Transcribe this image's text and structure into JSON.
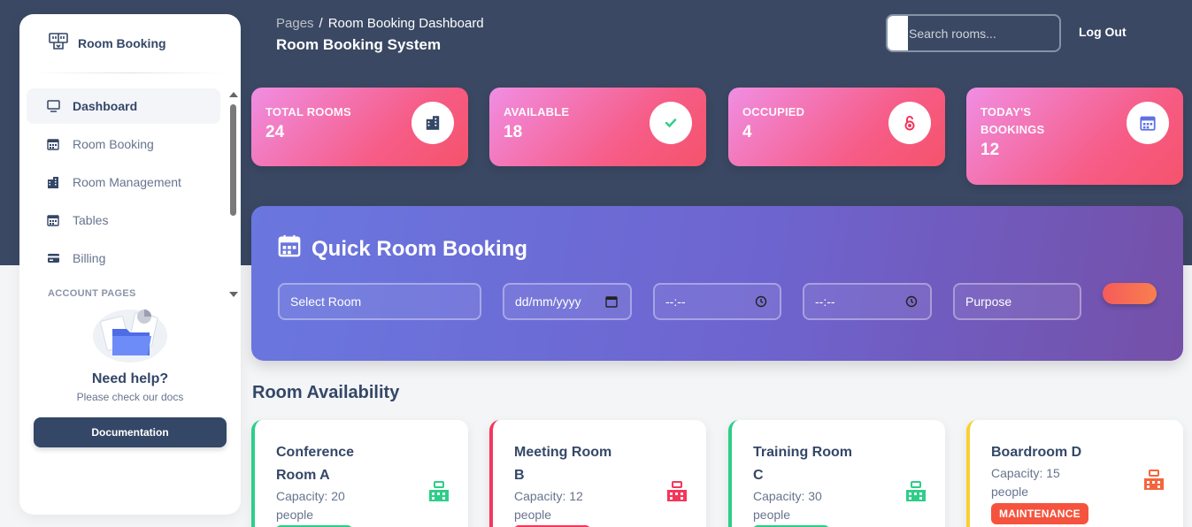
{
  "sidebar": {
    "brand": "Room Booking",
    "items": [
      {
        "label": "Dashboard",
        "icon": "monitor-icon",
        "active": true
      },
      {
        "label": "Room Booking",
        "icon": "calendar-icon"
      },
      {
        "label": "Room Management",
        "icon": "building-icon"
      },
      {
        "label": "Tables",
        "icon": "calendar-grid-icon"
      },
      {
        "label": "Billing",
        "icon": "credit-card-icon"
      }
    ],
    "section": "ACCOUNT PAGES",
    "help": {
      "title": "Need help?",
      "subtitle": "Please check our docs",
      "button": "Documentation"
    }
  },
  "header": {
    "breadcrumb_root": "Pages",
    "breadcrumb_sep": "/",
    "breadcrumb_current": "Room Booking Dashboard",
    "title": "Room Booking System",
    "search_placeholder": "Search rooms...",
    "logout": "Log Out"
  },
  "stats": [
    {
      "label": "TOTAL ROOMS",
      "value": "24",
      "icon": "building-icon",
      "icon_color": "#344767"
    },
    {
      "label": "AVAILABLE",
      "value": "18",
      "icon": "check-icon",
      "icon_color": "#2dce89"
    },
    {
      "label": "OCCUPIED",
      "value": "4",
      "icon": "unlock-icon",
      "icon_color": "#f5365c"
    },
    {
      "label": "TODAY'S BOOKINGS",
      "value": "12",
      "icon": "calendar-icon",
      "icon_color": "#5e72e4"
    }
  ],
  "quick_booking": {
    "title": "Quick Room Booking",
    "room_placeholder": "Select Room",
    "date_placeholder": "dd/mm/yyyy",
    "start_time_placeholder": "--:--",
    "end_time_placeholder": "--:--",
    "purpose_placeholder": "Purpose"
  },
  "availability": {
    "title": "Room Availability",
    "rooms": [
      {
        "name": "Conference Room A",
        "capacity": "Capacity: 20 people",
        "status_color": "#2dce89"
      },
      {
        "name": "Meeting Room B",
        "capacity": "Capacity: 12 people",
        "status_color": "#f5365c"
      },
      {
        "name": "Training Room C",
        "capacity": "Capacity: 30 people",
        "status_color": "#2dce89"
      },
      {
        "name": "Boardroom D",
        "capacity": "Capacity: 15 people",
        "status_color": "#fbcf33",
        "badge": "MAINTENANCE"
      }
    ]
  },
  "colors": {
    "header_bg": "#3a4863",
    "accent_dark": "#344767",
    "available": "#2dce89",
    "occupied": "#f5365c",
    "maintenance": "#fbcf33"
  }
}
